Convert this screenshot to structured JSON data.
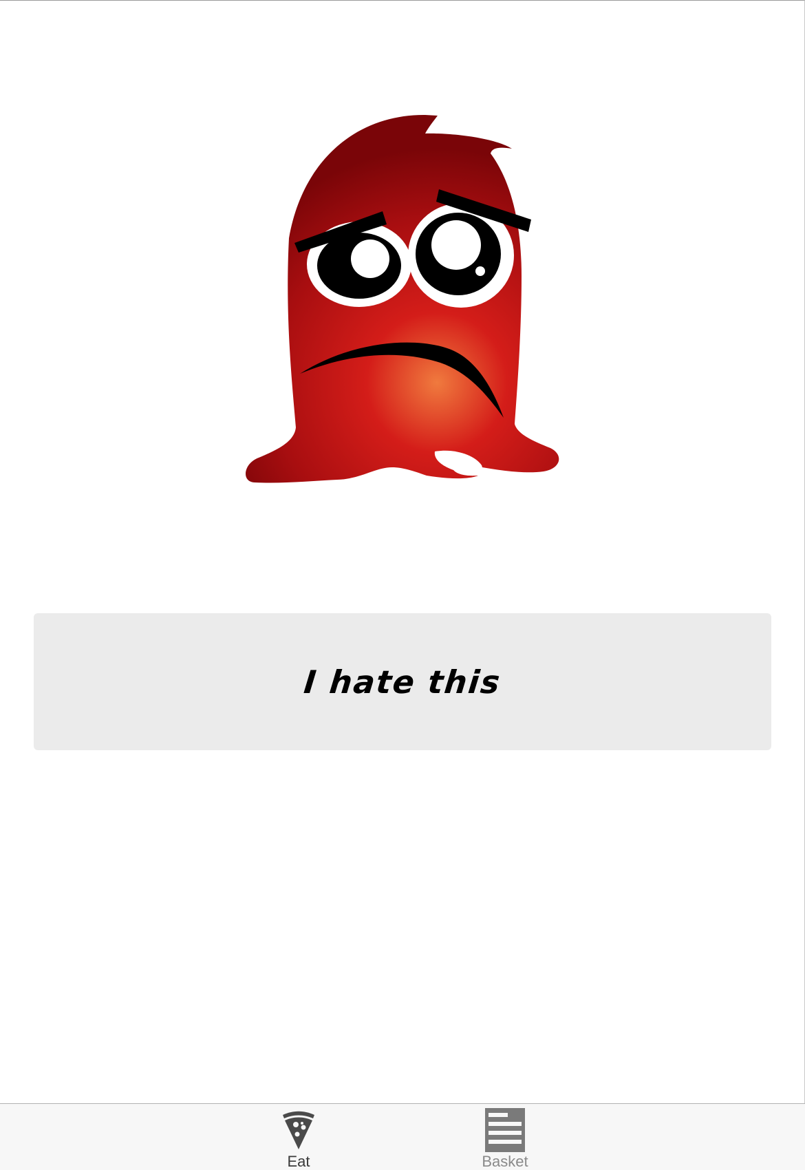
{
  "mood": {
    "text": "I hate this"
  },
  "illustration": {
    "subject": "sad-red-monster",
    "colors": {
      "body_dark": "#7a0508",
      "body_mid": "#c4171a",
      "body_highlight": "#f07a3e"
    }
  },
  "tab_bar": {
    "tabs": [
      {
        "label": "Eat",
        "icon": "pizza-slice-icon",
        "selected": true
      },
      {
        "label": "Basket",
        "icon": "list-icon",
        "selected": false
      }
    ]
  },
  "colors": {
    "card_background": "#ebebeb",
    "tab_bar_background": "#f7f7f7",
    "tab_selected": "#3a3a3a",
    "tab_unselected": "#8a8a8a"
  }
}
